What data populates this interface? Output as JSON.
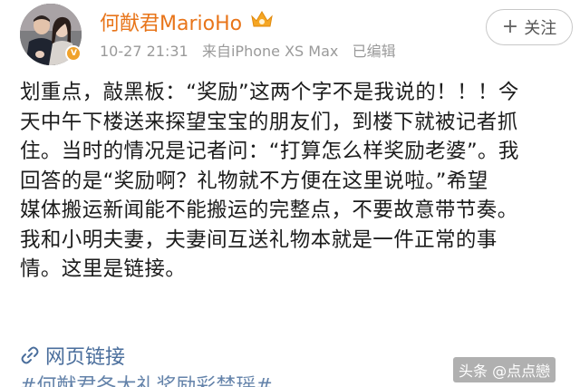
{
  "header": {
    "username": "何猷君MarioHo",
    "vip_icon": "vip-crown-icon",
    "timestamp": "10-27 21:31",
    "source": "来自iPhone XS Max",
    "edited": "已编辑",
    "follow_plus": "+",
    "follow_label": "关注"
  },
  "post": {
    "lines": [
      "划重点，敲黑板：“奖励”这两个字不是我说的！！！今",
      "天中午下楼送来探望宝宝的朋友们，到楼下就被记者抓",
      "住。当时的情况是记者问：“打算怎么样奖励老婆”。我",
      "回答的是“奖励啊？礼物就不方便在这里说啦。”希望",
      "媒体搬运新闻能不能搬运的完整点，不要故意带节奏。",
      "我和小明夫妻，夫妻间互送礼物本就是一件正常的事",
      "情。这里是链接。"
    ],
    "link_label": "网页链接",
    "hashtag": "#何猷君各大礼奖励彩禁瑶#"
  },
  "watermark": "头条 @点点戀",
  "colors": {
    "username": "#e8751a",
    "link": "#4a6e9c",
    "meta": "#9a9a9a"
  }
}
